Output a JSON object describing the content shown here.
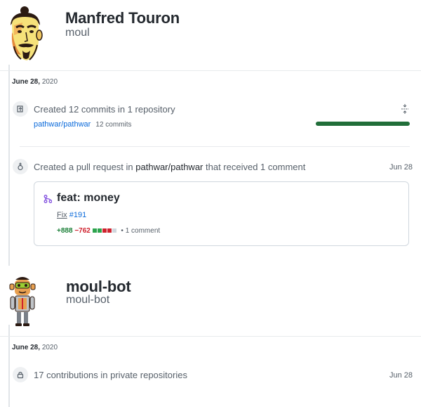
{
  "user1": {
    "name": "Manfred Touron",
    "login": "moul",
    "date_month_day": "June 28,",
    "date_year": "2020",
    "commits": {
      "text": "Created 12 commits in 1 repository",
      "repo": "pathwar/pathwar",
      "repo_commits": "12 commits",
      "progress": 1.0,
      "bar_color": "#216e39"
    },
    "pull_request": {
      "text_before": "Created a pull request in ",
      "repo": "pathwar/pathwar",
      "text_after": " that received 1 comment",
      "date": "Jun 28",
      "title": "feat: money",
      "fix_prefix": "Fix",
      "fix_issue": "#191",
      "additions": "+888",
      "deletions": "−762",
      "comment_count": "1 comment",
      "bullet": "•"
    }
  },
  "user2": {
    "name": "moul-bot",
    "login": "moul-bot",
    "date_month_day": "June 28,",
    "date_year": "2020",
    "private": {
      "text": "17 contributions in private repositories",
      "date": "Jun 28"
    }
  },
  "colors": {
    "link": "#0969da",
    "additions": "#1a7f37",
    "deletions": "#cf222e",
    "pr_icon": "#8250df"
  }
}
